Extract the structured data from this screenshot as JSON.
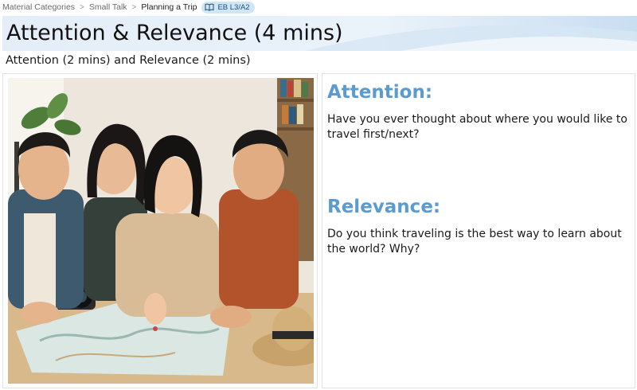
{
  "breadcrumb": {
    "items": [
      "Material Categories",
      "Small Talk",
      "Planning a Trip"
    ],
    "separator": ">",
    "level_badge": "EB L3/A2",
    "level_icon": "book-icon"
  },
  "slide": {
    "title": "Attention & Relevance (4 mins)",
    "subtitle": "Attention (2 mins) and Relevance (2 mins)",
    "image_description_icon": "photo-friends-planning-trip-with-map",
    "sections": [
      {
        "heading": "Attention:",
        "text": "Have you ever thought about where you would like to travel first/next?"
      },
      {
        "heading": "Relevance:",
        "text": "Do you think traveling is the best way to learn about the world? Why?"
      }
    ]
  },
  "colors": {
    "heading": "#5b9bd0",
    "badge_bg": "#cfe6f5",
    "title_band": "#dbe9f6"
  }
}
